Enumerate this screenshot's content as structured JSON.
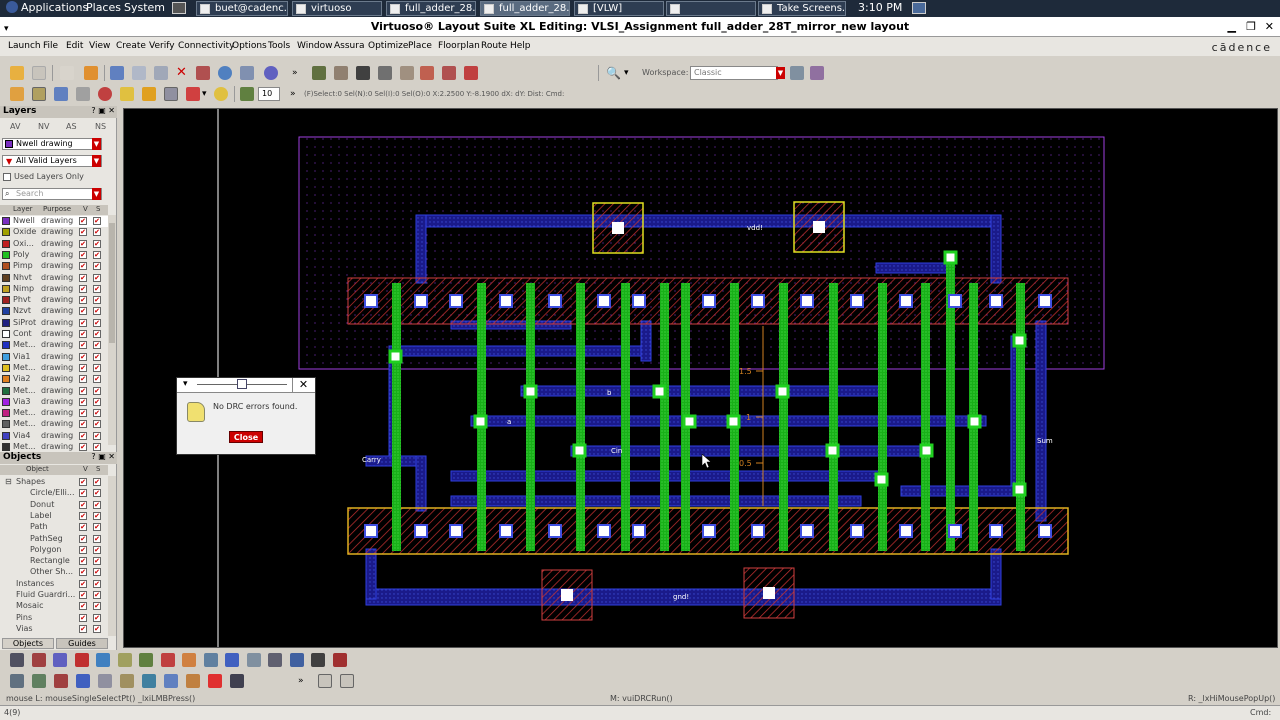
{
  "top_panel": {
    "menus": [
      "Applications",
      "Places",
      "System"
    ],
    "tasks": [
      "buet@cadenc...",
      "virtuoso",
      "full_adder_28...",
      "full_adder_28...",
      "[VLW]",
      "",
      "Take Screens..."
    ],
    "clock": "3:10 PM"
  },
  "window": {
    "title": "Virtuoso® Layout Suite XL Editing: VLSI_Assignment full_adder_28T_mirror_new layout",
    "brand": "cādence"
  },
  "menubar": [
    "Launch",
    "File",
    "Edit",
    "View",
    "Create",
    "Verify",
    "Connectivity",
    "Options",
    "Tools",
    "Window",
    "Assura",
    "Optimize",
    "Place",
    "Floorplan",
    "Route",
    "Help"
  ],
  "toolbar": {
    "workspace_label": "Workspace:",
    "workspace_value": "Classic",
    "grid_value": "10",
    "coord_readout": "(F)Select:0 Sel(N):0 Sel(I):0 Sel(O):0   X:2.2500 Y:-8.1900 dX: dY: Dist: Cmd:"
  },
  "layers_panel": {
    "title": "Layers",
    "tabs": [
      "AV",
      "NV",
      "AS",
      "NS"
    ],
    "current_layer": "Nwell drawing",
    "filter": "All Valid Layers",
    "used_only_label": "Used Layers Only",
    "search_placeholder": "Search",
    "col_layer": "Layer",
    "col_purpose": "Purpose",
    "col_v": "V",
    "col_s": "S",
    "rows": [
      {
        "name": "Nwell",
        "purpose": "drawing",
        "color": "#7a2fc0"
      },
      {
        "name": "Oxide",
        "purpose": "drawing",
        "color": "#a0a000"
      },
      {
        "name": "Oxi...",
        "purpose": "drawing",
        "color": "#c02020"
      },
      {
        "name": "Poly",
        "purpose": "drawing",
        "color": "#20c020"
      },
      {
        "name": "Pimp",
        "purpose": "drawing",
        "color": "#b05020"
      },
      {
        "name": "Nhvt",
        "purpose": "drawing",
        "color": "#604020"
      },
      {
        "name": "Nimp",
        "purpose": "drawing",
        "color": "#c0a020"
      },
      {
        "name": "Phvt",
        "purpose": "drawing",
        "color": "#a02020"
      },
      {
        "name": "Nzvt",
        "purpose": "drawing",
        "color": "#2040a0"
      },
      {
        "name": "SiProt",
        "purpose": "drawing",
        "color": "#202080"
      },
      {
        "name": "Cont",
        "purpose": "drawing",
        "color": "#ffffff"
      },
      {
        "name": "Met...",
        "purpose": "drawing",
        "color": "#2030c0"
      },
      {
        "name": "Via1",
        "purpose": "drawing",
        "color": "#40a0e0"
      },
      {
        "name": "Met...",
        "purpose": "drawing",
        "color": "#e0c020"
      },
      {
        "name": "Via2",
        "purpose": "drawing",
        "color": "#e08020"
      },
      {
        "name": "Met...",
        "purpose": "drawing",
        "color": "#207040"
      },
      {
        "name": "Via3",
        "purpose": "drawing",
        "color": "#a020e0"
      },
      {
        "name": "Met...",
        "purpose": "drawing",
        "color": "#c02080"
      },
      {
        "name": "Met...",
        "purpose": "drawing",
        "color": "#606060"
      },
      {
        "name": "Via4",
        "purpose": "drawing",
        "color": "#4040c0"
      },
      {
        "name": "Met...",
        "purpose": "drawing",
        "color": "#303030"
      }
    ]
  },
  "objects_panel": {
    "title": "Objects",
    "col_object": "Object",
    "col_v": "V",
    "col_s": "S",
    "rows": [
      "Shapes",
      "Circle/Elli...",
      "Donut",
      "Label",
      "Path",
      "PathSeg",
      "Polygon",
      "Rectangle",
      "Other Sh...",
      "Instances",
      "Fluid Guardri...",
      "Mosaic",
      "Pins",
      "Vias"
    ],
    "bottom_tabs": [
      "Objects",
      "Guides"
    ]
  },
  "canvas": {
    "labels": {
      "vdd": "vdd!",
      "gnd": "gnd!",
      "carry": "Carry",
      "sum": "Sum",
      "cin": "Cin",
      "a": "a",
      "b": "b"
    },
    "ruler_ticks": [
      "1.5",
      "1",
      "0.5"
    ]
  },
  "dialog": {
    "message": "No DRC errors found.",
    "close_label": "Close"
  },
  "status": {
    "left": "mouse L: mouseSingleSelectPt() _lxiLMBPress()",
    "middle": "M: vuiDRCRun()",
    "right": "R: _lxHiMousePopUp()",
    "counter": "4(9)",
    "cmd_label": "Cmd:"
  }
}
